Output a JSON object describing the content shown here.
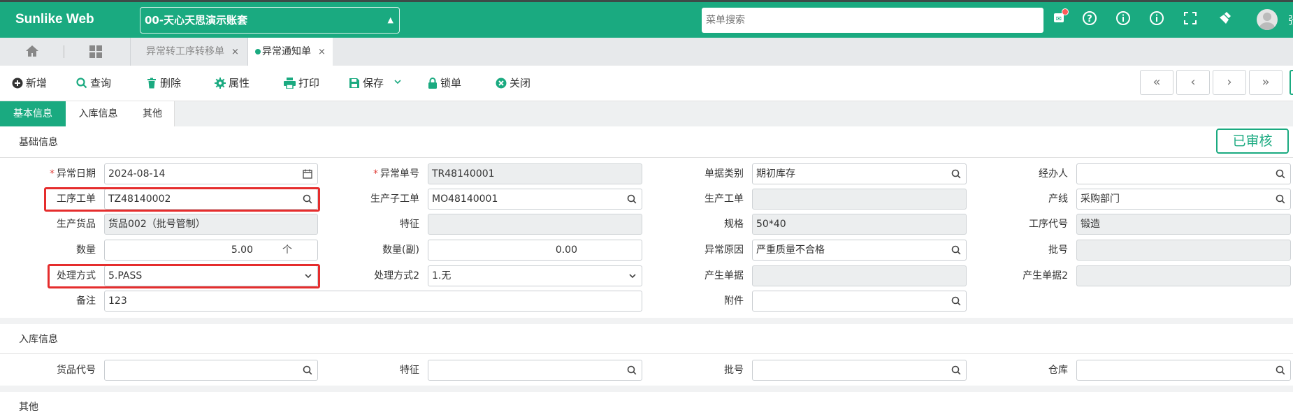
{
  "app": {
    "logo": "Sunlike Web",
    "account": "00-天心天思演示账套",
    "search_placeholder": "菜单搜索",
    "user_partial": "张"
  },
  "tabs": [
    {
      "label": "异常转工序转移单",
      "close": "×"
    },
    {
      "label": "异常通知单",
      "close": "×"
    }
  ],
  "toolbar": {
    "add": "新增",
    "query": "查询",
    "delete": "删除",
    "props": "属性",
    "print": "打印",
    "save": "保存",
    "lock": "锁单",
    "close": "关闭"
  },
  "nav": {
    "first": "«",
    "prev": "‹",
    "next": "›",
    "last": "»"
  },
  "form_tabs": {
    "basic": "基本信息",
    "inbound": "入库信息",
    "other": "其他"
  },
  "sections": {
    "basic": "基础信息",
    "inbound": "入库信息",
    "other": "其他"
  },
  "status_stamp": "已审核",
  "labels": {
    "exc_date": "异常日期",
    "exc_no": "异常单号",
    "doc_type": "单据类别",
    "handler": "经办人",
    "proc_order": "工序工单",
    "sub_order": "生产子工单",
    "prod_order": "生产工单",
    "line": "产线",
    "goods": "生产货品",
    "feature": "特征",
    "spec": "规格",
    "proc_code": "工序代号",
    "qty": "数量",
    "qty_aux": "数量(副)",
    "exc_reason": "异常原因",
    "batch": "批号",
    "method": "处理方式",
    "method2": "处理方式2",
    "gen_doc": "产生单据",
    "gen_doc2": "产生单据2",
    "remark": "备注",
    "attach": "附件",
    "in_goods": "货品代号",
    "in_feature": "特征",
    "in_batch": "批号",
    "in_warehouse": "仓库"
  },
  "values": {
    "exc_date": "2024-08-14",
    "exc_no": "TR48140001",
    "doc_type": "期初库存",
    "handler": "",
    "proc_order": "TZ48140002",
    "sub_order": "MO48140001",
    "prod_order": "",
    "line": "采购部门",
    "goods": "货品002（批号管制）",
    "feature": "",
    "spec": "50*40",
    "proc_code": "锻造",
    "qty": "5.00",
    "qty_unit": "个",
    "qty_aux": "0.00",
    "exc_reason": "严重质量不合格",
    "batch": "",
    "method": "5.PASS",
    "method2": "1.无",
    "gen_doc": "",
    "gen_doc2": "",
    "remark": "123",
    "attach": "",
    "in_goods": "",
    "in_feature": "",
    "in_batch": "",
    "in_warehouse": ""
  },
  "colors": {
    "brand": "#1aaa80",
    "highlight": "#e52d2d"
  }
}
